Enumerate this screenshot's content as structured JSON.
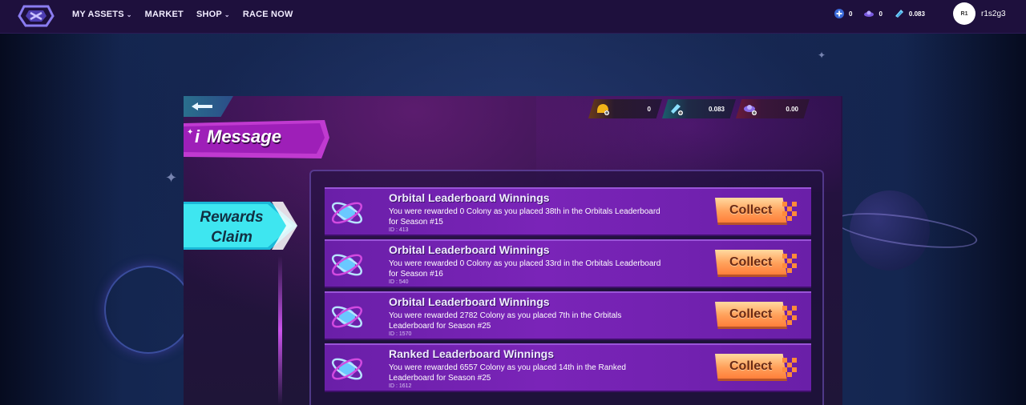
{
  "nav": {
    "items": [
      {
        "label": "MY ASSETS",
        "has_dropdown": true
      },
      {
        "label": "MARKET",
        "has_dropdown": false
      },
      {
        "label": "SHOP",
        "has_dropdown": true
      },
      {
        "label": "RACE NOW",
        "has_dropdown": false
      }
    ],
    "balances": [
      {
        "icon": "plus-coin-icon",
        "value": "0"
      },
      {
        "icon": "ship-icon",
        "value": "0"
      },
      {
        "icon": "crystal-icon",
        "value": "0.083"
      }
    ],
    "user": {
      "avatar_initials": "R1",
      "name": "r1s2g3"
    }
  },
  "game": {
    "title_prefix": "i",
    "title": "Message",
    "resources": [
      {
        "icon": "gold-helmet-icon",
        "value": "0"
      },
      {
        "icon": "crystal-plus-icon",
        "value": "0.083"
      },
      {
        "icon": "ship-plus-icon",
        "value": "0.00"
      }
    ],
    "side_tab": {
      "line1": "Rewards",
      "line2": "Claim"
    },
    "messages": [
      {
        "title": "Orbital Leaderboard Winnings",
        "body": "You were rewarded 0 Colony as you placed 38th in the Orbitals Leaderboard for Season #15",
        "id": "ID : 413",
        "button": "Collect"
      },
      {
        "title": "Orbital Leaderboard Winnings",
        "body": "You were rewarded 0 Colony as you placed 33rd in the Orbitals Leaderboard for Season #16",
        "id": "ID : 540",
        "button": "Collect"
      },
      {
        "title": "Orbital Leaderboard Winnings",
        "body": "You were rewarded 2782 Colony as you placed 7th in the Orbitals Leaderboard for Season #25",
        "id": "ID : 1570",
        "button": "Collect"
      },
      {
        "title": "Ranked Leaderboard Winnings",
        "body": "You were rewarded 6557 Colony as you placed 14th in the Ranked Leaderboard for Season #25",
        "id": "ID : 1612",
        "button": "Collect"
      }
    ]
  },
  "colors": {
    "nav_bg": "#1e103d",
    "panel_bg": "#2a1047",
    "message_bg": "#7a24b8",
    "collect_button": "#ffa05a",
    "side_tab": "#3ee6f0"
  }
}
